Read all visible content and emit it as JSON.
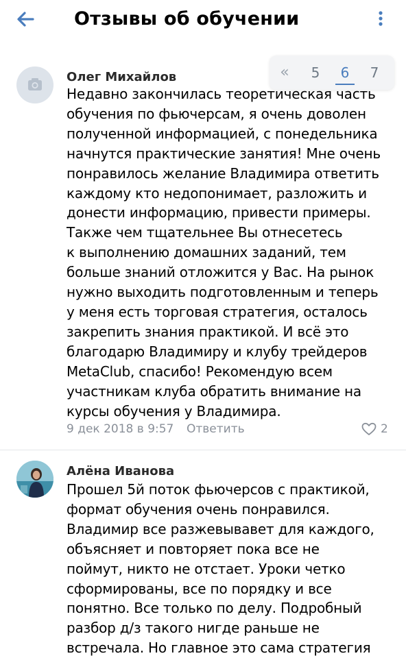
{
  "header": {
    "title": "Отзывы об обучении",
    "back_icon": "arrow-left-icon",
    "more_icon": "more-vertical-icon"
  },
  "pager": {
    "prev_label": "«",
    "pages": [
      "5",
      "6",
      "7"
    ],
    "current": "6"
  },
  "comments": [
    {
      "author": "Олег Михайлов",
      "avatar_icon": "camera-icon",
      "text": "Недавно закончилась теоретическая часть\nобучения по фьючерсам, я очень доволен\nполученной информацией, с понедельника\nначнутся практические занятия! Мне очень\nпонравилось желание Владимира ответить\nкаждому кто недопонимает, разложить и\nдонести информацию, привести примеры.\nТакже чем тщательнее Вы отнесетесь\nк выполнению домашних заданий, тем\nбольше знаний отложится у Вас. На рынок\nнужно выходить подготовленным и теперь\nу меня есть торговая стратегия, осталось\nзакрепить знания практикой. И всё это\nблагодарю Владимиру и клубу трейдеров\nMetaClub, спасибо! Рекомендую всем\nучастникам клуба обратить внимание на\nкурсы обучения у Владимира.",
      "date": "9 дек 2018 в 9:57",
      "reply_label": "Ответить",
      "likes": "2"
    },
    {
      "author": "Алёна Иванова",
      "avatar_icon": "user-photo-avatar",
      "text": "Прошел 5й поток фьючерсов с практикой,\nформат обучения очень понравился.\nВладимир все разжевывавет для каждого,\nобъясняет и повторяет пока все не\nпоймут, никто не отстает. Уроки четко\nсформированы, все по порядку и все\nпонятно. Все только по делу. Подробный\nразбор д/з такого нигде раньше не\nвстречала. Но главное это сама стратегия"
    }
  ],
  "colors": {
    "accent": "#4a7dbd",
    "secondary_text": "#8a9099",
    "divider": "#e3e6ea",
    "pager_bg": "#f3f4f6"
  }
}
